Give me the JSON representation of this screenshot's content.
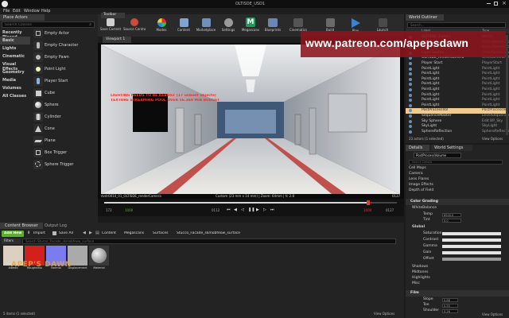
{
  "window": {
    "title": "OLTISDE_USD1"
  },
  "menu": [
    "File",
    "Edit",
    "Window",
    "Help"
  ],
  "place_actors": {
    "tab": "Place Actors",
    "search_placeholder": "Search Classes",
    "categories": [
      "Recently Placed",
      "Basic",
      "Lights",
      "Cinematic",
      "Visual Effects",
      "Geometry",
      "Media",
      "Volumes",
      "All Classes"
    ],
    "active_category": "Basic",
    "actors": [
      "Empty Actor",
      "Empty Character",
      "Empty Pawn",
      "Point Light",
      "Player Start",
      "Cube",
      "Sphere",
      "Cylinder",
      "Cone",
      "Plane",
      "Box Trigger",
      "Sphere Trigger"
    ]
  },
  "toolbar": {
    "tab": "Toolbar",
    "buttons": [
      "Save Current",
      "Source Control",
      "Modes",
      "Content",
      "Marketplace",
      "Settings",
      "Megascans",
      "Blueprints",
      "Cinematics",
      "Build",
      "Play",
      "Launch"
    ]
  },
  "viewport": {
    "tab": "Viewport 1",
    "warning_line1": "LIGHTING NEEDS TO BE REBUILT (17 unbuilt objects)",
    "warning_line2": "TEXTURE STREAMING POOL OVER 56.369 MiB BUDGET",
    "camera_label": "dvdr0010_01_OLTISDE_renderCamera",
    "info_label": "Custom (23 mm x 14 mm) | Zoom: 64mm | fc 2.8",
    "frame_right": "0127",
    "timeline_start": "172",
    "timeline_mid_left": "1000",
    "timeline_cur": "0112",
    "timeline_end_left": "1000",
    "timeline_end": "0127"
  },
  "outliner": {
    "tab": "World Outliner",
    "search_placeholder": "Search...",
    "col_label": "Label",
    "col_type": "Type",
    "rows": [
      {
        "label": "OLTISDE (Editor)",
        "type": "World"
      },
      {
        "label": "Cube",
        "type": "StaticMeshActor"
      },
      {
        "label": "Floor",
        "type": "StaticMeshActor"
      },
      {
        "label": "Light Source",
        "type": "DirectionalLight"
      },
      {
        "label": "OLTISDE_renderCamera",
        "type": "CineCameraActor"
      },
      {
        "label": "Player Start",
        "type": "PlayerStart"
      },
      {
        "label": "PointLight",
        "type": "PointLight"
      },
      {
        "label": "PointLight",
        "type": "PointLight"
      },
      {
        "label": "PointLight",
        "type": "PointLight"
      },
      {
        "label": "PointLight",
        "type": "PointLight"
      },
      {
        "label": "PointLight",
        "type": "PointLight"
      },
      {
        "label": "PointLight",
        "type": "PointLight"
      },
      {
        "label": "PointLight",
        "type": "PointLight"
      },
      {
        "label": "PointLight",
        "type": "PointLight"
      },
      {
        "label": "PostProcessVol",
        "type": "PostProcessVolume"
      },
      {
        "label": "SequenceMaster",
        "type": "LevelSequenceActor"
      },
      {
        "label": "Sky Sphere",
        "type": "Edit BP_Sky"
      },
      {
        "label": "SkyLight",
        "type": "SkyLight"
      },
      {
        "label": "SphereReflection",
        "type": "SphereReflectionCapture"
      }
    ],
    "selected_index": 14,
    "footer": "23 actors (1 selected)",
    "view_options": "View Options"
  },
  "details": {
    "tab_details": "Details",
    "tab_world": "World Settings",
    "object_name": "PostProcessVolume",
    "search_placeholder": "Search Details",
    "rows_top": [
      "Cell Maps",
      "Camera",
      "Lens Flares",
      "Image Effects",
      "Depth of Field"
    ],
    "section_color": "Color Grading",
    "sub_whitebalance": "WhiteBalance",
    "wb_rows": [
      {
        "label": "Temp",
        "value": "6500.0"
      },
      {
        "label": "Tint",
        "value": "0.0"
      }
    ],
    "section_global": "Global",
    "global_rows": [
      "Saturation",
      "Contrast",
      "Gamma",
      "Gain",
      "Offset"
    ],
    "section_more": [
      "Shadows",
      "Midtones",
      "Highlights",
      "Misc"
    ],
    "section_film": "Film",
    "film_rows": [
      {
        "label": "Slope",
        "value": "0.88"
      },
      {
        "label": "Toe",
        "value": "0.55"
      },
      {
        "label": "Shoulder",
        "value": "0.26"
      }
    ],
    "view_options": "View Options"
  },
  "content_browser": {
    "tab": "Content Browser",
    "tab2": "Output Log",
    "add_new": "Add New",
    "import": "Import",
    "save_all": "Save All",
    "path": [
      "Content",
      "Megascans",
      "Surfaces",
      "Stucco_Facade_skmobfeow_surface"
    ],
    "filters": "Filters",
    "search_placeholder": "Search Stucco_Facade_skmobfeow_surface",
    "assets": [
      {
        "label": "Albedo",
        "color": "#dcd0c2"
      },
      {
        "label": "Roughness",
        "color": "#d3201c"
      },
      {
        "label": "Normal",
        "color": "#7b7cf0"
      },
      {
        "label": "Displacement",
        "color": "#aaaaaa"
      },
      {
        "label": "Material",
        "color": "#6b6b6b"
      }
    ],
    "footer": "5 items (1 selected)",
    "view_options": "View Options"
  },
  "watermark": {
    "text": "www.patreon.com/apepsdawn",
    "overlay_text": "APEP'S DAWN"
  },
  "colors": {
    "accent_selection": "#f0ca8f",
    "add_new_green": "#5cae2e",
    "watermark_red": "#8c141c",
    "play_blue": "#3e82cf"
  }
}
